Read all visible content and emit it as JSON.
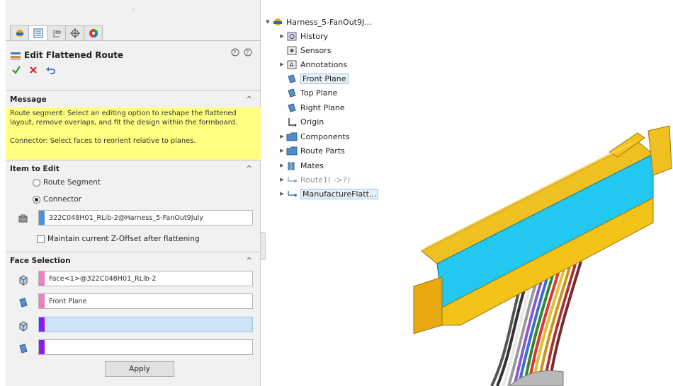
{
  "panel": {
    "title": "Edit Flattened Route",
    "help_labels": [
      "",
      ""
    ],
    "tabs": [
      "feature-manager",
      "property-manager",
      "configuration-manager",
      "dimxpert-manager",
      "display-manager"
    ],
    "sections": {
      "message": {
        "header": "Message",
        "text_1": "Route segment: Select an editing option to reshape the flattened layout, remove overlaps, and fit the design within the formboard.",
        "text_2": "Connector: Select faces to reorient relative to planes."
      },
      "item_to_edit": {
        "header": "Item to Edit",
        "option_route_segment": "Route Segment",
        "option_connector": "Connector",
        "selected_option": "Connector",
        "connector_value": "322C048H01_RLib-2@Harness_5-FanOut9July",
        "maintain_z_offset_label": "Maintain current Z-Offset after flattening"
      },
      "face_selection": {
        "header": "Face Selection",
        "face_1": "Face<1>@322C048H01_RLib-2",
        "face_2": "Front Plane",
        "face_3": "",
        "face_4": ""
      }
    },
    "apply_label": "Apply",
    "colors": {
      "message_bg": "#ffff80",
      "swatch_blue": "#4a90e2",
      "swatch_pink": "#f17cc0",
      "swatch_purple": "#8b1cf0"
    }
  },
  "tree": {
    "root": "Harness_5-FanOut9J...",
    "items": [
      {
        "label": "History",
        "icon": "history-icon"
      },
      {
        "label": "Sensors",
        "icon": "sensors-icon"
      },
      {
        "label": "Annotations",
        "icon": "annotations-icon"
      },
      {
        "label": "Front Plane",
        "icon": "plane-icon"
      },
      {
        "label": "Top Plane",
        "icon": "plane-icon"
      },
      {
        "label": "Right Plane",
        "icon": "plane-icon"
      },
      {
        "label": "Origin",
        "icon": "origin-icon"
      },
      {
        "label": "Components",
        "icon": "folder-icon"
      },
      {
        "label": "Route Parts",
        "icon": "folder-icon"
      },
      {
        "label": "Mates",
        "icon": "mates-icon"
      },
      {
        "label": "Route1( ->?)",
        "icon": "route-icon"
      },
      {
        "label": "ManufactureFlatt...",
        "icon": "route-icon"
      }
    ]
  }
}
